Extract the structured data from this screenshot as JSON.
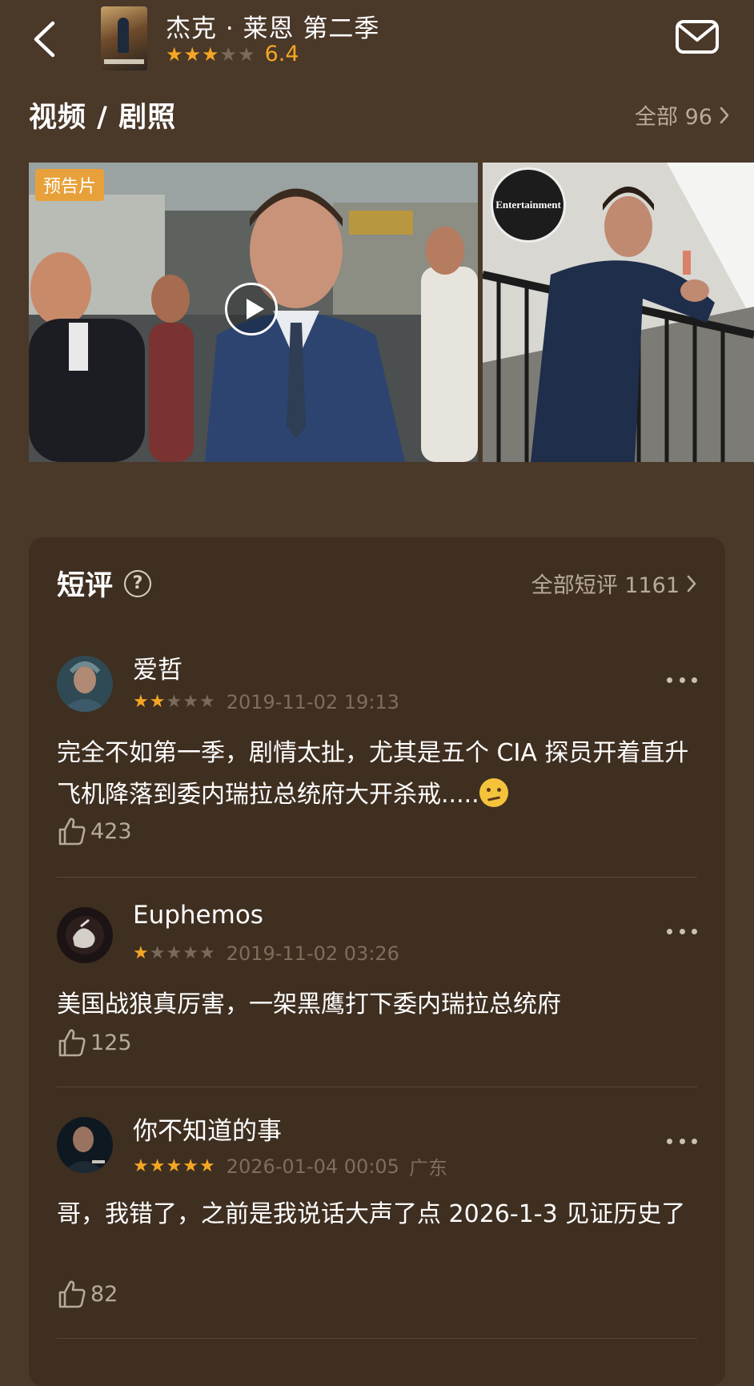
{
  "header": {
    "back_icon": "chevron-left-icon",
    "title": "杰克 · 莱恩 第二季",
    "stars": [
      1,
      1,
      1,
      0,
      0
    ],
    "score": "6.4",
    "mail_icon": "envelope-icon"
  },
  "media": {
    "title": "视频 / 剧照",
    "more_label": "全部 96",
    "trailer_badge": "预告片",
    "play_icon": "play-icon",
    "photo_logo": "Entertainment"
  },
  "comments": {
    "title": "短评",
    "help_icon": "question-circle-icon",
    "more_label": "全部短评 1161",
    "items": [
      {
        "name": "爱哲",
        "stars": [
          1,
          1,
          0,
          0,
          0
        ],
        "date": "2019-11-02 19:13",
        "location": "",
        "text": "完全不如第一季，剧情太扯，尤其是五个 CIA 探员开着直升飞机降落到委内瑞拉总统府大开杀戒.....",
        "emoji": "thinking-face-emoji",
        "likes": "423"
      },
      {
        "name": "Euphemos",
        "stars": [
          1,
          0,
          0,
          0,
          0
        ],
        "date": "2019-11-02 03:26",
        "location": "",
        "text": "美国战狼真厉害，一架黑鹰打下委内瑞拉总统府",
        "likes": "125"
      },
      {
        "name": "你不知道的事",
        "stars": [
          1,
          1,
          1,
          1,
          1
        ],
        "date": "2026-01-04 00:05",
        "location": "广东",
        "text": "哥，我错了，之前是我说话大声了点 2026-1-3 见证历史了",
        "likes": "82"
      }
    ]
  },
  "colors": {
    "background": "#4a3829",
    "card": "#3f2f21",
    "accent_star": "#f5a623",
    "muted_text": "#b8aa9b",
    "date_text": "#7f6e5e",
    "trailer_badge": "#e8a13a"
  }
}
